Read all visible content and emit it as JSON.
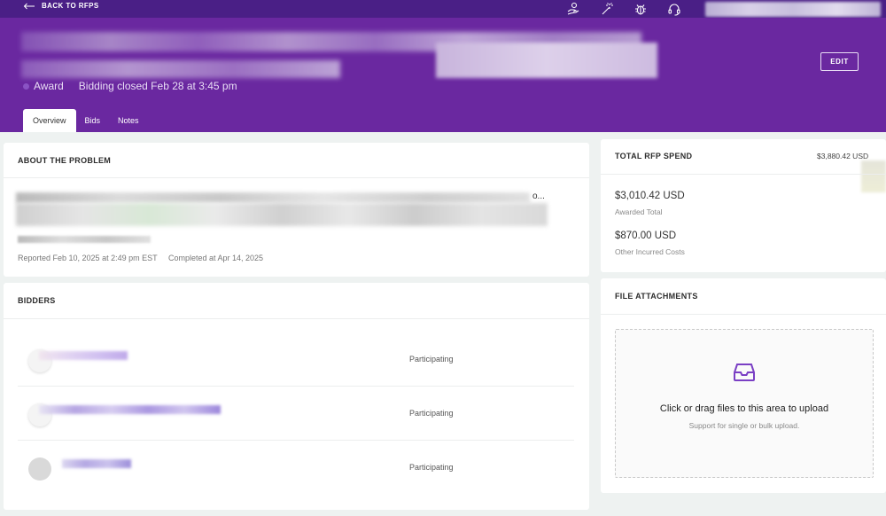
{
  "topbar": {
    "back_label": "BACK TO RFPS",
    "icons": [
      "hand-coin-icon",
      "magic-wand-icon",
      "bug-icon",
      "headset-icon"
    ]
  },
  "header": {
    "status_label": "Award",
    "bidding_closed": "Bidding closed Feb 28 at 3:45 pm",
    "edit_label": "EDIT"
  },
  "tabs": [
    {
      "label": "Overview",
      "active": true
    },
    {
      "label": "Bids",
      "active": false
    },
    {
      "label": "Notes",
      "active": false
    }
  ],
  "about": {
    "title": "ABOUT THE PROBLEM",
    "description_ellipsis": "o...",
    "reported": "Reported Feb 10, 2025 at 2:49 pm EST",
    "completed": "Completed at Apr 14, 2025"
  },
  "bidders": {
    "title": "BIDDERS",
    "rows": [
      {
        "status": "Participating"
      },
      {
        "status": "Participating"
      },
      {
        "status": "Participating"
      }
    ]
  },
  "spend": {
    "title": "TOTAL RFP SPEND",
    "total": "$3,880.42 USD",
    "awarded_amount": "$3,010.42 USD",
    "awarded_label": "Awarded Total",
    "other_amount": "$870.00 USD",
    "other_label": "Other Incurred Costs"
  },
  "files": {
    "title": "FILE ATTACHMENTS",
    "upload_text": "Click or drag files to this area to upload",
    "upload_hint": "Support for single or bulk upload."
  },
  "colors": {
    "header_purple": "#6a28a0",
    "topbar_purple": "#4a1f86",
    "accent": "#7a3fc4"
  }
}
